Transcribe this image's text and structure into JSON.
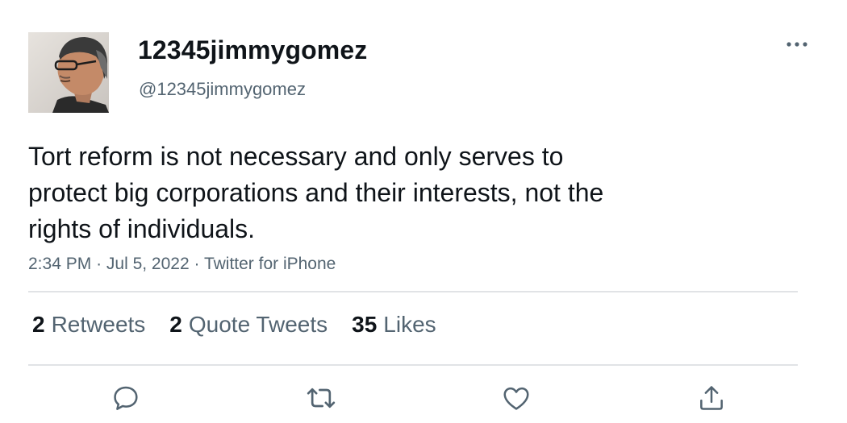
{
  "user": {
    "display_name": "12345jimmygomez",
    "handle": "@12345jimmygomez"
  },
  "tweet": {
    "lines": [
      "Tort reform is not necessary and only serves to",
      "protect big corporations and their interests, not the",
      "rights of individuals."
    ],
    "time": "2:34 PM",
    "date": "Jul 5, 2022",
    "source": "Twitter for iPhone",
    "sep": "·"
  },
  "stats": {
    "retweets": {
      "count": "2",
      "label": "Retweets"
    },
    "quote_tweets": {
      "count": "2",
      "label": "Quote Tweets"
    },
    "likes": {
      "count": "35",
      "label": "Likes"
    }
  },
  "icons": {
    "more": "more-horizontal-icon",
    "reply": "reply-icon",
    "retweet": "retweet-icon",
    "like": "heart-icon",
    "share": "share-icon"
  },
  "colors": {
    "text": "#0f1419",
    "secondary": "#536471",
    "divider": "#e1e3e6"
  }
}
